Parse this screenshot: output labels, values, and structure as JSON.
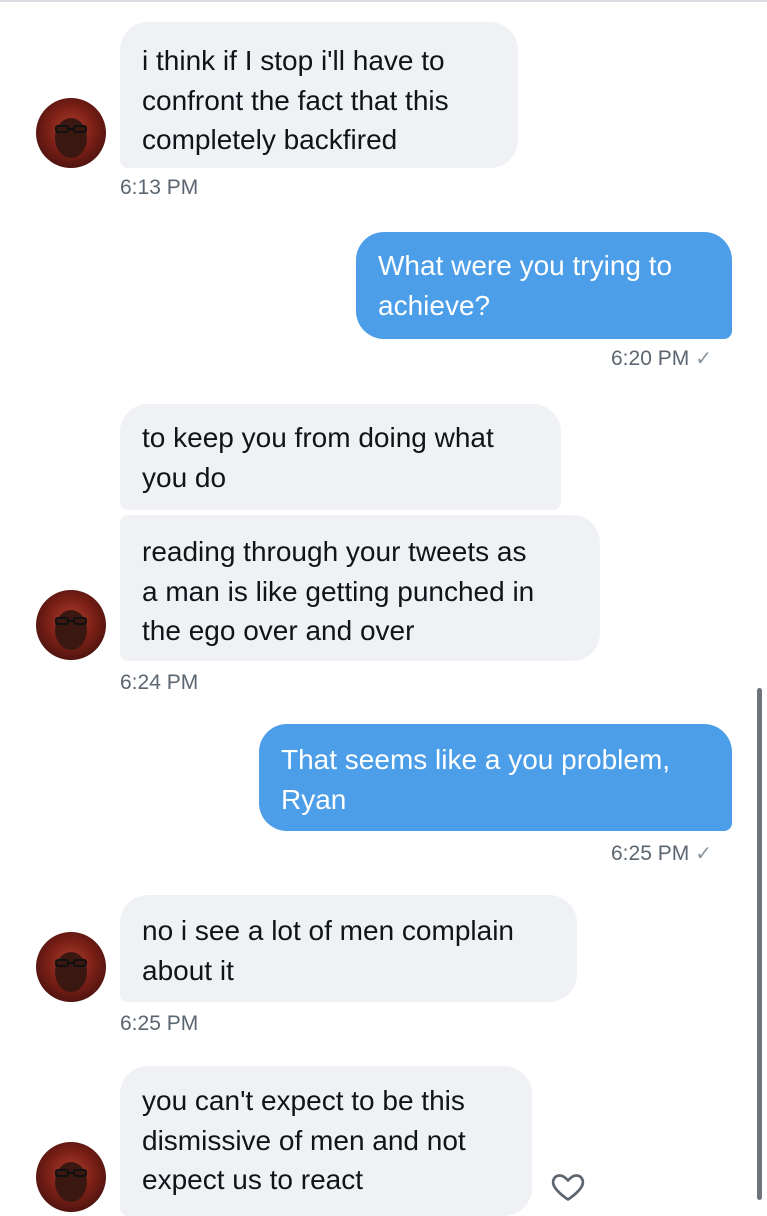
{
  "conversation": {
    "messages": [
      {
        "id": "m1",
        "direction": "in",
        "lines": [
          "i think if I stop i'll have to",
          "confront the fact that this",
          "completely backfired"
        ]
      },
      {
        "id": "m2",
        "direction": "out",
        "lines": [
          "What were you trying to",
          "achieve?"
        ]
      },
      {
        "id": "m3",
        "direction": "in",
        "lines": [
          "to keep you from doing what",
          "you do"
        ]
      },
      {
        "id": "m4",
        "direction": "in",
        "lines": [
          "reading through your tweets as",
          "a man is like getting punched in",
          "the ego over and over"
        ]
      },
      {
        "id": "m5",
        "direction": "out",
        "lines": [
          "That seems like a you problem,",
          "Ryan"
        ]
      },
      {
        "id": "m6",
        "direction": "in",
        "lines": [
          "no i see a lot of men complain",
          "about it"
        ]
      },
      {
        "id": "m7",
        "direction": "in",
        "lines": [
          "you can't expect to be this",
          "dismissive of men and not",
          "expect us to react"
        ]
      }
    ],
    "timestamps": {
      "t1": "6:13 PM",
      "t2": "6:20 PM",
      "t3": "6:24 PM",
      "t4": "6:25 PM",
      "t5": "6:25 PM"
    },
    "read_check": "✓"
  },
  "icons": {
    "avatar": "avatar-photo",
    "heart": "heart-outline-icon"
  },
  "colors": {
    "incoming_bubble": "#eff1f4",
    "outgoing_bubble": "#4c9ee8",
    "timestamp": "#5b6670"
  }
}
